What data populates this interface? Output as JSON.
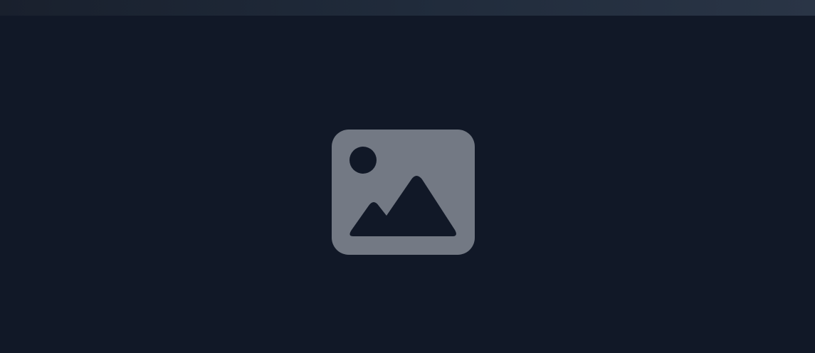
{
  "colors": {
    "background": "#111827",
    "topbar_start": "#19202d",
    "topbar_end": "#2a3546",
    "icon": "#737984"
  },
  "media": {
    "icon": "image-placeholder-icon"
  }
}
